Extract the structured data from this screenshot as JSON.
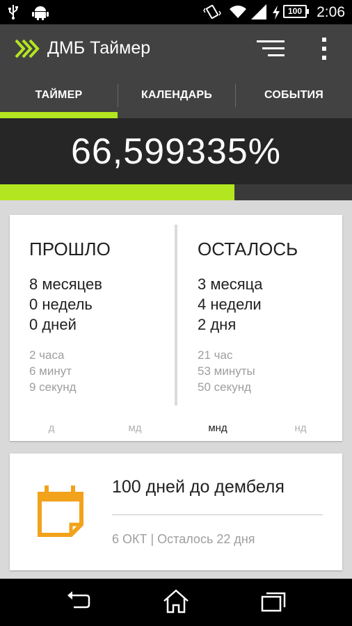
{
  "status_bar": {
    "time": "2:06",
    "battery": "100",
    "icons": [
      "usb-icon",
      "android-icon",
      "vibrate-icon",
      "wifi-icon",
      "signal-icon",
      "battery-charging-icon"
    ]
  },
  "app_bar": {
    "title": "ДМБ Таймер",
    "logo_icon": "double-chevron-logo-icon",
    "actions": [
      "sort-menu-icon",
      "overflow-menu-icon"
    ]
  },
  "tabs": [
    {
      "label": "ТАЙМЕР",
      "selected": true
    },
    {
      "label": "КАЛЕНДАРЬ",
      "selected": false
    },
    {
      "label": "СОБЫТИЯ",
      "selected": false
    }
  ],
  "progress": {
    "percent_text": "66,599335%",
    "fraction": 0.666
  },
  "elapsed": {
    "title": "ПРОШЛО",
    "big": [
      "8 месяцев",
      "0 недель",
      "0 дней"
    ],
    "small": [
      "2 часа",
      "6 минут",
      "9 секунд"
    ]
  },
  "remaining": {
    "title": "ОСТАЛОСЬ",
    "big": [
      "3 месяца",
      "4 недели",
      "2 дня"
    ],
    "small": [
      "21 час",
      "53 минуты",
      "50 секунд"
    ]
  },
  "formats": [
    {
      "label": "д",
      "active": false
    },
    {
      "label": "мд",
      "active": false
    },
    {
      "label": "мнд",
      "active": true
    },
    {
      "label": "нд",
      "active": false
    }
  ],
  "event": {
    "title": "100 дней до дембеля",
    "subtitle": "6 ОКТ | Осталось 22 дня",
    "icon": "calendar-icon"
  },
  "colors": {
    "accent": "#b3e620",
    "toolbar": "#424242",
    "banner": "#262626",
    "calendar": "#f2a21b"
  },
  "nav_bar": [
    "back-icon",
    "home-icon",
    "recent-apps-icon"
  ]
}
